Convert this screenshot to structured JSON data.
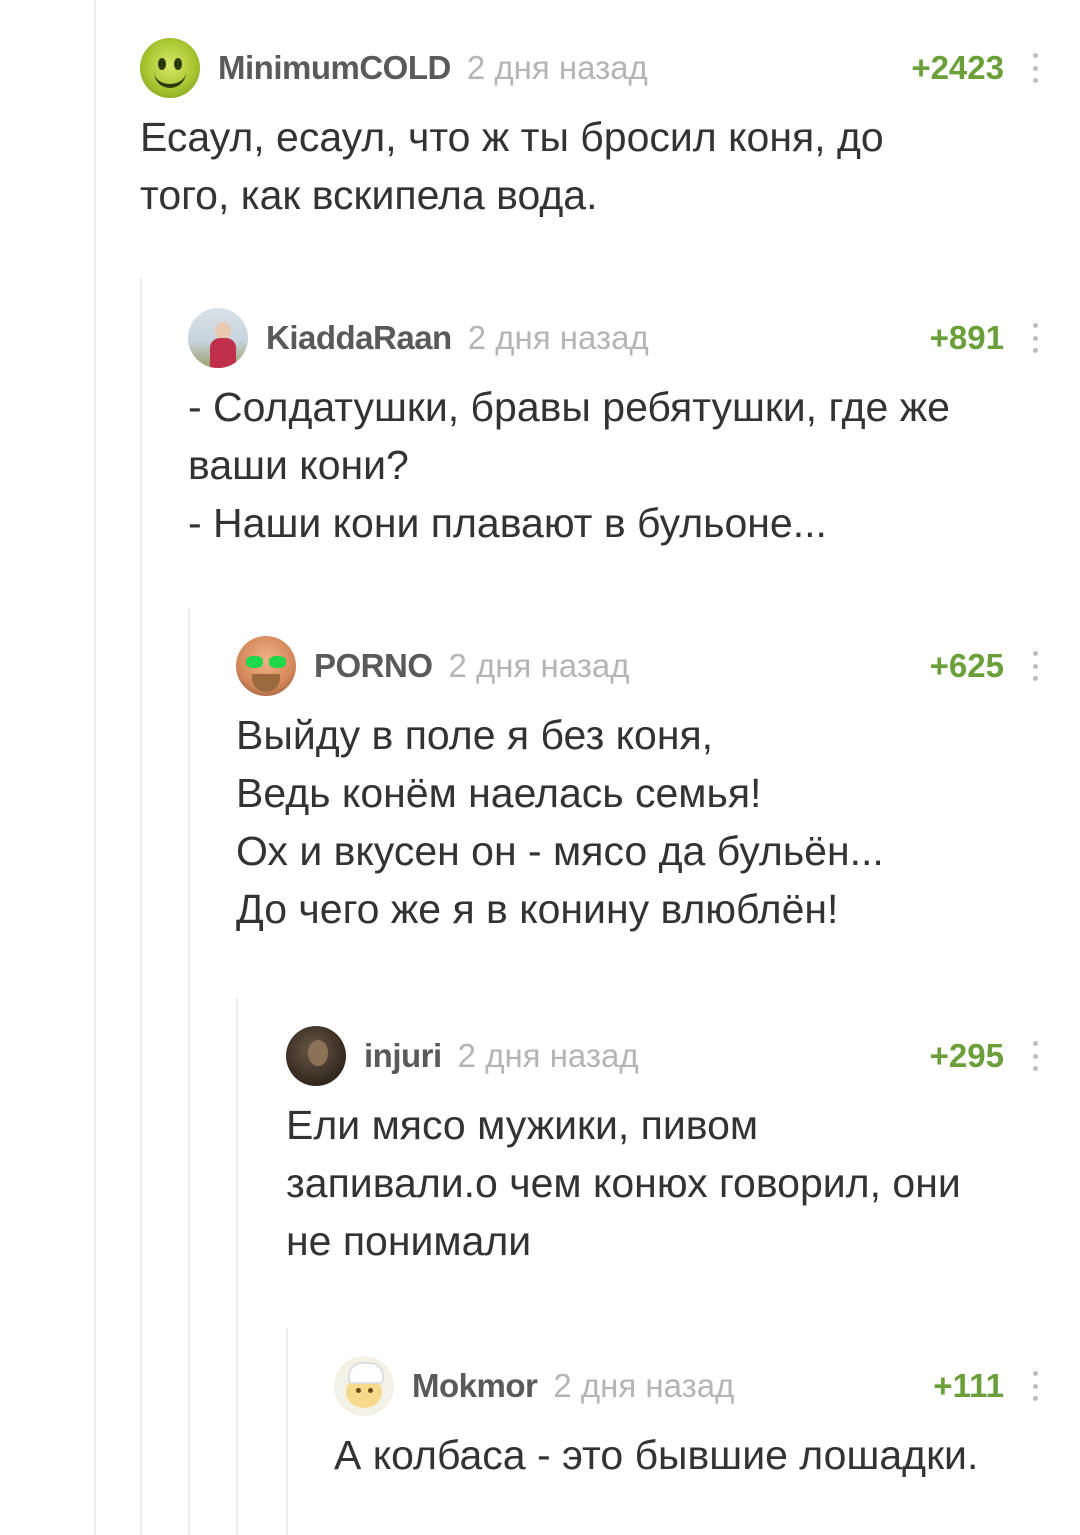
{
  "comments": [
    {
      "username": "MinimumCOLD",
      "time": "2 дня назад",
      "rating": "+2423",
      "avatar_icon": "smiley-avatar-icon",
      "lines": [
        "Есаул, есаул, что ж ты бросил коня, до",
        "того, как вскипела вода."
      ]
    },
    {
      "username": "KiaddaRaan",
      "time": "2 дня назад",
      "rating": "+891",
      "avatar_icon": "user-photo-avatar-icon",
      "lines": [
        "- Солдатушки, бравы ребятушки, где же",
        "ваши кони?",
        "- Наши кони плавают в бульоне..."
      ]
    },
    {
      "username": "PORNO",
      "time": "2 дня назад",
      "rating": "+625",
      "avatar_icon": "glasses-avatar-icon",
      "lines": [
        "Выйду в поле я без коня,",
        "Ведь конём наелась семья!",
        "Ох и вкусен он - мясо да бульён...",
        "До чего же я в конину влюблён!"
      ]
    },
    {
      "username": "injuri",
      "time": "2 дня назад",
      "rating": "+295",
      "avatar_icon": "user-photo-avatar-icon",
      "lines": [
        "Ели мясо мужики, пивом",
        "запивали.о чем конюх говорил, они",
        "не понимали"
      ]
    },
    {
      "username": "Mokmor",
      "time": "2 дня назад",
      "rating": "+111",
      "avatar_icon": "chef-avatar-icon",
      "lines": [
        "А колбаса - это бывшие лошадки."
      ]
    }
  ],
  "colors": {
    "rating": "#6a9f3a",
    "username": "#5a5a5a",
    "time": "#b5b5b5",
    "text": "#333333",
    "thread_line": "#ececec"
  },
  "icons": {
    "more": "vertical-dots-icon"
  }
}
